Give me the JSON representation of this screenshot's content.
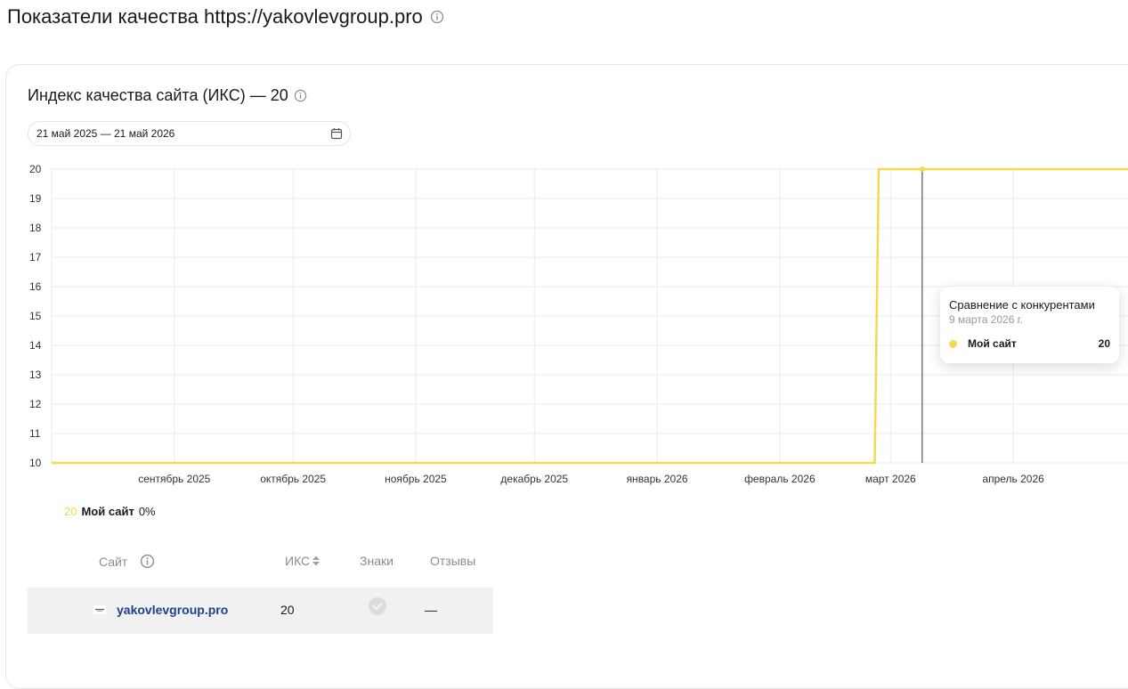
{
  "page": {
    "title": "Показатели качества https://yakovlevgroup.pro"
  },
  "card": {
    "title": "Индекс качества сайта (ИКС) — 20",
    "date_range": "21 май 2025 — 21 май 2026"
  },
  "chart_data": {
    "type": "line",
    "y_ticks": [
      "20",
      "19",
      "18",
      "17",
      "16",
      "15",
      "14",
      "13",
      "12",
      "11",
      "10"
    ],
    "ylim": [
      10,
      20
    ],
    "x_tick_labels": [
      "сентябрь 2025",
      "октябрь 2025",
      "ноябрь 2025",
      "декабрь 2025",
      "январь 2026",
      "февраль 2026",
      "март 2026",
      "апрель 2026"
    ],
    "series": [
      {
        "name": "Мой сайт",
        "color": "#f5d94e",
        "points": [
          {
            "x": "2025-08-01",
            "y": 10
          },
          {
            "x": "2026-02-25",
            "y": 10
          },
          {
            "x": "2026-02-26",
            "y": 20
          },
          {
            "x": "2026-04-30",
            "y": 20
          }
        ]
      }
    ],
    "hover_x": "2026-03-09",
    "grid": true
  },
  "tooltip": {
    "title": "Сравнение с конкурентами",
    "date": "9 марта 2026 г.",
    "series_name": "Мой сайт",
    "value": "20",
    "dot_color": "#f5d94e"
  },
  "legend": {
    "value": "20",
    "name": "Мой сайт",
    "percent": "0%",
    "value_color": "#f5d94e"
  },
  "table": {
    "headers": {
      "site": "Сайт",
      "iks": "ИКС",
      "signs": "Знаки",
      "reviews": "Отзывы"
    },
    "rows": [
      {
        "site": "yakovlevgroup.pro",
        "iks": "20",
        "reviews": "—"
      }
    ]
  }
}
